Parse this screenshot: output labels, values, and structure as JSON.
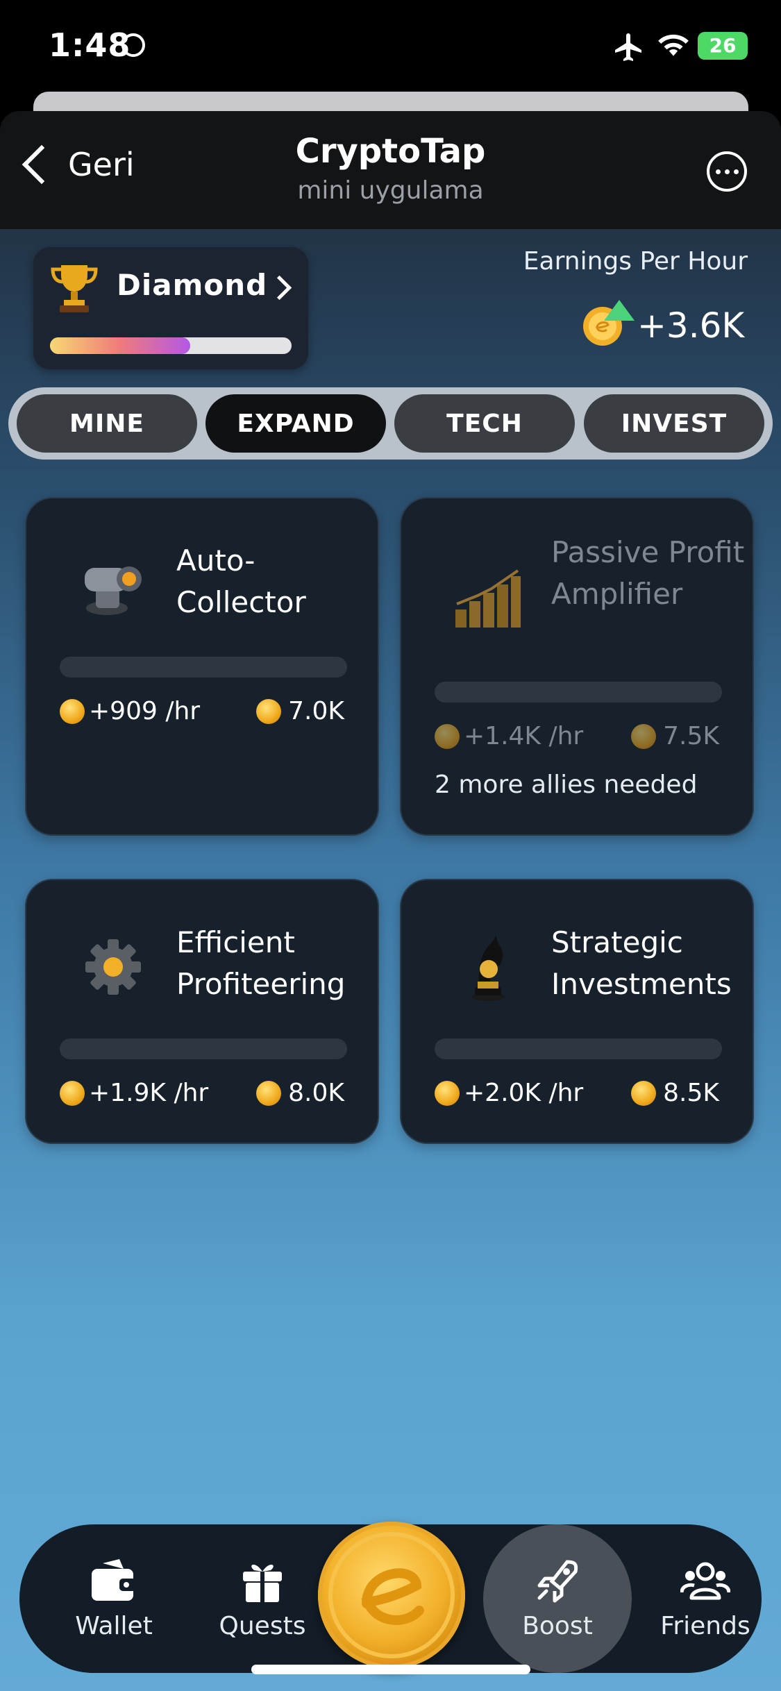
{
  "status_bar": {
    "time": "1:48",
    "battery": "26"
  },
  "nav": {
    "back_label": "Geri",
    "title": "CryptoTap",
    "subtitle": "mini uygulama"
  },
  "rank": {
    "label": "Diamond",
    "progress": 0.58
  },
  "earnings": {
    "label": "Earnings Per Hour",
    "value": "+3.6K"
  },
  "tabs": [
    {
      "label": "MINE",
      "active": false
    },
    {
      "label": "EXPAND",
      "active": true
    },
    {
      "label": "TECH",
      "active": false
    },
    {
      "label": "INVEST",
      "active": false
    }
  ],
  "cards": [
    {
      "title": "Auto-Collector",
      "rate": "+909 /hr",
      "cost": "7.0K",
      "locked": false,
      "icon": "cannon-icon"
    },
    {
      "title": "Passive Profit Amplifier",
      "rate": "+1.4K /hr",
      "cost": "7.5K",
      "locked": true,
      "note": "2 more allies needed",
      "icon": "coin-stacks-icon"
    },
    {
      "title": "Efficient Profiteering",
      "rate": "+1.9K /hr",
      "cost": "8.0K",
      "locked": false,
      "icon": "gear-icon"
    },
    {
      "title": "Strategic Investments",
      "rate": "+2.0K /hr",
      "cost": "8.5K",
      "locked": false,
      "icon": "chess-knight-icon"
    }
  ],
  "bottom_nav": {
    "wallet": "Wallet",
    "quests": "Quests",
    "boost": "Boost",
    "friends": "Friends",
    "active": "boost"
  },
  "colors": {
    "accent_green": "#4cd37a",
    "coin_gold": "#f2b029"
  }
}
